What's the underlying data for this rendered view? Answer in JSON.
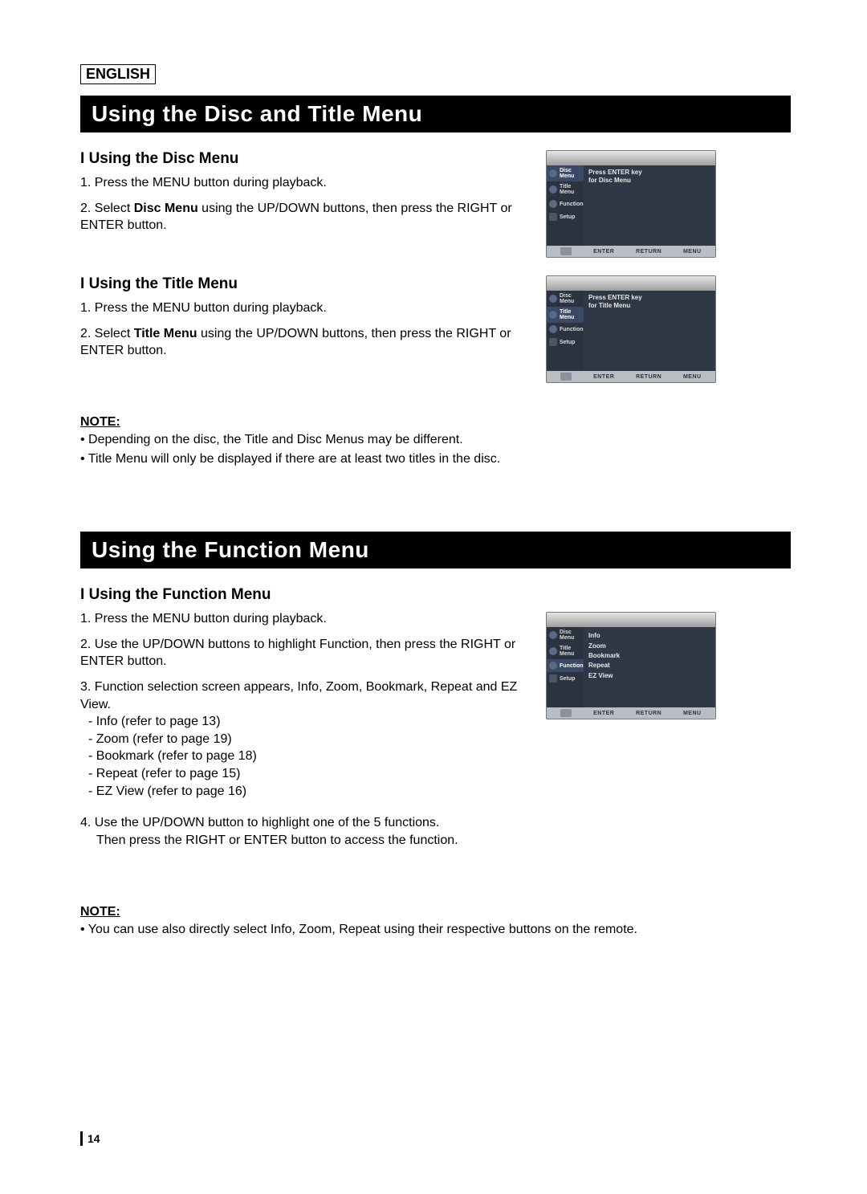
{
  "language_label": "ENGLISH",
  "page_number": "14",
  "banner1": "Using the Disc and Title Menu",
  "banner2": "Using the Function Menu",
  "section_disc_menu": {
    "heading_prefix": "I",
    "heading": "Using the Disc Menu",
    "step1_num": "1.",
    "step1_text": "Press the MENU button during playback.",
    "step2_num": "2.",
    "step2_pre": "Select ",
    "step2_bold": "Disc Menu",
    "step2_post": " using the UP/DOWN buttons, then press the RIGHT or ENTER button."
  },
  "section_title_menu": {
    "heading_prefix": "I",
    "heading": "Using the Title Menu",
    "step1_num": "1.",
    "step1_text": "Press the MENU button during playback.",
    "step2_num": "2.",
    "step2_pre": "Select ",
    "step2_bold": "Title Menu",
    "step2_post": " using the UP/DOWN buttons, then press the RIGHT or ENTER button."
  },
  "note1": {
    "label": "NOTE:",
    "b1": "• Depending on the disc, the Title and Disc Menus may be different.",
    "b2": "• Title Menu will only be displayed if there are at least two titles in the disc."
  },
  "section_function_menu": {
    "heading_prefix": "I",
    "heading": "Using the Function Menu",
    "step1_num": "1.",
    "step1_text": "Press the MENU button during playback.",
    "step2_num": "2.",
    "step2_text": "Use the UP/DOWN buttons to highlight Function, then press the RIGHT or ENTER button.",
    "step3_num": "3.",
    "step3_text": "Function selection screen appears, Info, Zoom, Bookmark, Repeat and EZ View.",
    "step3_sub1": "- Info (refer to page 13)",
    "step3_sub2": "- Zoom (refer to page 19)",
    "step3_sub3": "- Bookmark (refer to page 18)",
    "step3_sub4": "- Repeat (refer to page 15)",
    "step3_sub5": "- EZ View (refer to page 16)",
    "step4_num": "4.",
    "step4_line1": "Use the UP/DOWN button to highlight one of the 5 functions.",
    "step4_line2": "Then press the RIGHT or ENTER button to access the function."
  },
  "note2": {
    "label": "NOTE:",
    "b1": "• You can use also directly select Info, Zoom, Repeat using their respective buttons on the remote."
  },
  "osd_common": {
    "side": {
      "disc_menu": "Disc Menu",
      "title_menu": "Title Menu",
      "function": "Function",
      "setup": "Setup"
    },
    "footer": {
      "enter": "ENTER",
      "return": "RETURN",
      "menu": "MENU"
    }
  },
  "osd1_main_line1": "Press ENTER key",
  "osd1_main_line2": "for Disc Menu",
  "osd2_main_line1": "Press ENTER key",
  "osd2_main_line2": "for Title Menu",
  "osd3_items": {
    "i0": "Info",
    "i1": "Zoom",
    "i2": "Bookmark",
    "i3": "Repeat",
    "i4": "EZ View"
  }
}
